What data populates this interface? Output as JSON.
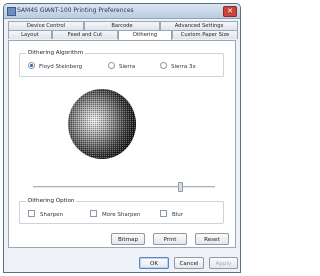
{
  "window": {
    "title": "SAM4S GIANT-100 Printing Preferences"
  },
  "tabs_row1": [
    {
      "label": "Device Control"
    },
    {
      "label": "Barcode"
    },
    {
      "label": "Advanced Settings"
    }
  ],
  "tabs_row2": [
    {
      "label": "Layout"
    },
    {
      "label": "Feed and Cut"
    },
    {
      "label": "Dithering",
      "active": true
    },
    {
      "label": "Custom Paper Size"
    }
  ],
  "dithering_algorithm": {
    "label": "Dithering Algorithm",
    "options": [
      {
        "label": "Floyd Steinberg",
        "selected": true
      },
      {
        "label": "Sierra",
        "selected": false
      },
      {
        "label": "Sierra 3x",
        "selected": false
      }
    ]
  },
  "preview": {
    "icon": "dithered-sphere"
  },
  "slider": {
    "value_fraction": 0.8
  },
  "dithering_option": {
    "label": "Dithering Option",
    "options": [
      {
        "label": "Sharpen",
        "checked": false
      },
      {
        "label": "More Sharpen",
        "checked": false
      },
      {
        "label": "Blur",
        "checked": false
      }
    ]
  },
  "actions": {
    "bitmap": "Bitmap",
    "print": "Print",
    "reset": "Reset"
  },
  "dialog_buttons": {
    "ok": "OK",
    "cancel": "Cancel",
    "apply": "Apply"
  }
}
